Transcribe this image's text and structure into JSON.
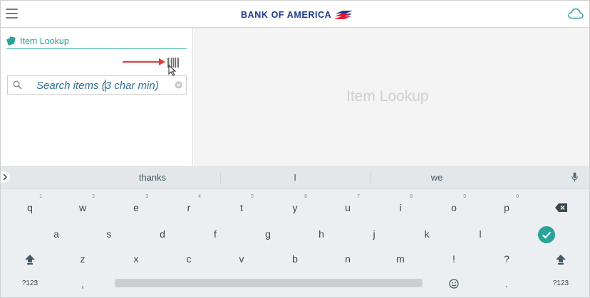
{
  "header": {
    "brand_name": "BANK OF AMERICA",
    "brand_colors": {
      "navy": "#1d3a8a",
      "red": "#e31837"
    },
    "menu_icon": "hamburger-menu-icon",
    "sync_icon": "cloud-icon"
  },
  "left_panel": {
    "title": "Item Lookup",
    "title_icon": "tag-icon",
    "barcode_icon": "barcode-icon",
    "search": {
      "placeholder": "Search items (3 char min)",
      "value": ""
    },
    "accent_color": "#2aa39a"
  },
  "right_panel": {
    "placeholder": "Item Lookup"
  },
  "keyboard": {
    "suggestions": [
      "thanks",
      "I",
      "we"
    ],
    "row1": [
      {
        "key": "q",
        "hint": "1"
      },
      {
        "key": "w",
        "hint": "2"
      },
      {
        "key": "e",
        "hint": "3"
      },
      {
        "key": "r",
        "hint": "4"
      },
      {
        "key": "t",
        "hint": "5"
      },
      {
        "key": "y",
        "hint": "6"
      },
      {
        "key": "u",
        "hint": "7"
      },
      {
        "key": "i",
        "hint": "8"
      },
      {
        "key": "o",
        "hint": "9"
      },
      {
        "key": "p",
        "hint": "0"
      }
    ],
    "row2": [
      "a",
      "s",
      "d",
      "f",
      "g",
      "h",
      "j",
      "k",
      "l"
    ],
    "row3": [
      "z",
      "x",
      "c",
      "v",
      "b",
      "n",
      "m",
      "!",
      "?"
    ],
    "bottom": {
      "symbols_left": "?123",
      "comma": ",",
      "period": ".",
      "symbols_right": "?123"
    }
  }
}
